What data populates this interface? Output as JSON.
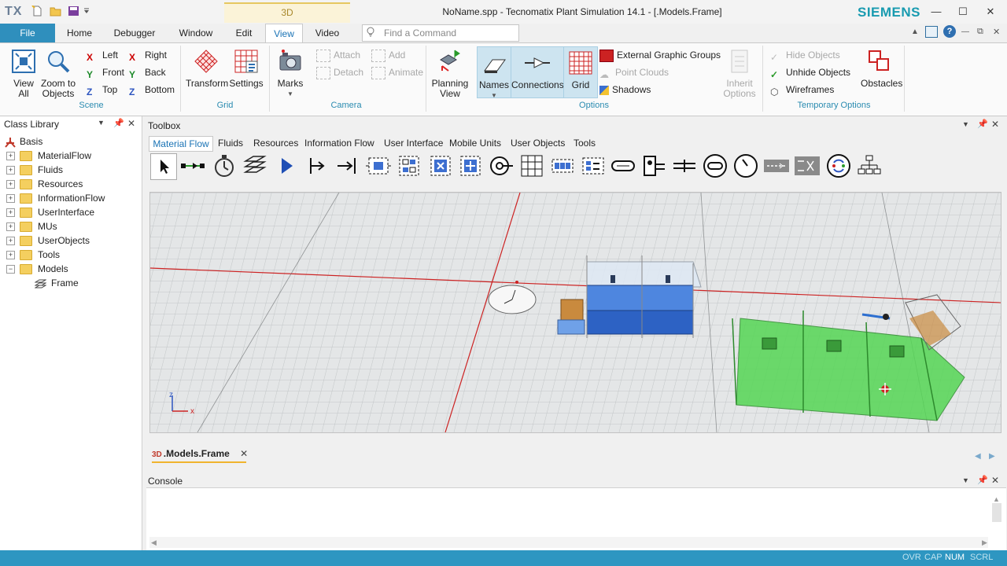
{
  "app": {
    "logo": "TX",
    "context_tab": "3D",
    "window_title": "NoName.spp - Tecnomatix Plant Simulation 14.1 - [.Models.Frame]",
    "brand": "SIEMENS"
  },
  "ribbon_tabs": [
    "File",
    "Home",
    "Debugger",
    "Window",
    "Edit",
    "View",
    "Video"
  ],
  "active_tab": "View",
  "command_search": {
    "placeholder": "Find a Command"
  },
  "groups": {
    "scene": {
      "name": "Scene",
      "view_all": "View All",
      "zoom_to_objects": "Zoom to Objects",
      "left": "Left",
      "right": "Right",
      "front": "Front",
      "back": "Back",
      "top": "Top",
      "bottom": "Bottom"
    },
    "grid": {
      "name": "Grid",
      "transform": "Transform",
      "settings": "Settings"
    },
    "camera": {
      "name": "Camera",
      "marks": "Marks",
      "attach": "Attach",
      "detach": "Detach",
      "add": "Add",
      "animate": "Animate"
    },
    "options": {
      "name": "Options",
      "planning_view": "Planning View",
      "names": "Names",
      "connections": "Connections",
      "grid": "Grid",
      "external_graphic_groups": "External Graphic Groups",
      "point_clouds": "Point Clouds",
      "shadows": "Shadows",
      "inherit_options": "Inherit Options"
    },
    "temporary_options": {
      "name": "Temporary Options",
      "hide_objects": "Hide Objects",
      "unhide_objects": "Unhide Objects",
      "wireframes": "Wireframes",
      "obstacles": "Obstacles"
    }
  },
  "class_library": {
    "title": "Class Library",
    "root": "Basis",
    "items": [
      "MaterialFlow",
      "Fluids",
      "Resources",
      "InformationFlow",
      "UserInterface",
      "MUs",
      "UserObjects",
      "Tools",
      "Models"
    ],
    "model_child": "Frame"
  },
  "toolbox": {
    "title": "Toolbox",
    "tabs": [
      "Material Flow",
      "Fluids",
      "Resources",
      "Information Flow",
      "User Interface",
      "Mobile Units",
      "User Objects",
      "Tools"
    ],
    "active_tab": "Material Flow"
  },
  "document_tab": {
    "label": ".Models.Frame",
    "badge": "3D"
  },
  "console": {
    "title": "Console"
  },
  "status": [
    "OVR",
    "CAP",
    "NUM",
    "SCRL"
  ],
  "status_active": "NUM",
  "colors": {
    "accent": "#2e96c1",
    "brand": "#199bb0",
    "station_green": "#55d655",
    "conveyor_blue": "#2d6fd0"
  }
}
